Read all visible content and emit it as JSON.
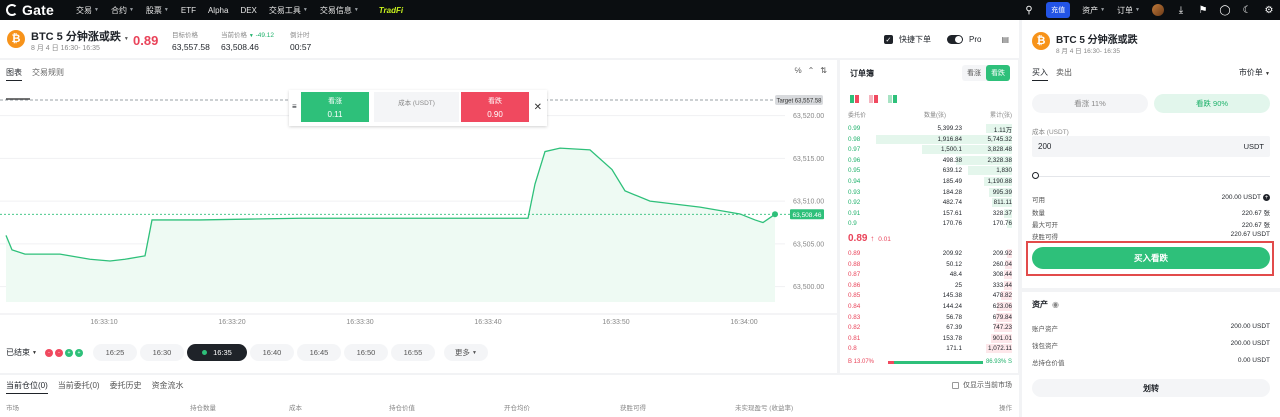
{
  "nav": {
    "brand": "Gate",
    "items": [
      "交易",
      "合约",
      "股票",
      "ETF",
      "Alpha",
      "DEX",
      "交易工具",
      "交易信息"
    ],
    "has_caret": [
      true,
      true,
      true,
      false,
      false,
      false,
      true,
      true
    ],
    "tradfi": "TradFi",
    "deposit": "充值",
    "assets": "资产",
    "orders": "订单"
  },
  "header": {
    "title": "BTC 5 分钟涨或跌",
    "subtitle": "8 月 4 日 16:30- 16:35",
    "price": "0.89",
    "target_label": "目标价格",
    "target_value": "63,557.58",
    "current_label": "当前价格",
    "current_value": "63,508.46",
    "current_change": "-49.12",
    "countdown_label": "倒计时",
    "countdown_value": "00:57",
    "quick_order": "快捷下单",
    "pro": "Pro"
  },
  "chart_tabs": [
    "图表",
    "交易规则"
  ],
  "popover": {
    "up_label": "看涨",
    "up_value": "0.11",
    "cost_label": "成本 (USDT)",
    "down_label": "看跌",
    "down_value": "0.90"
  },
  "chart_data": {
    "type": "line",
    "x_ticks": [
      "16:33:10",
      "16:33:20",
      "16:33:30",
      "16:33:40",
      "16:33:50",
      "16:34:00"
    ],
    "y_ticks": [
      63500,
      63505,
      63510,
      63515,
      63520
    ],
    "ylim": [
      63498.2,
      63522.3
    ],
    "x_range": [
      63,
      822
    ],
    "series": [
      {
        "name": "",
        "x": [
          6,
          12,
          25,
          60,
          90,
          110,
          125,
          145,
          152,
          200,
          250,
          300,
          400,
          480,
          500,
          528,
          535,
          545,
          560,
          590,
          612,
          625,
          650,
          700,
          740,
          755,
          763,
          775
        ],
        "y": [
          63506.0,
          63504.3,
          63503.8,
          63503.8,
          63503.2,
          63503.0,
          63503.2,
          63503.6,
          63507.8,
          63507.8,
          63507.9,
          63508.0,
          63508.0,
          63508.0,
          63508.0,
          63508.0,
          63512.0,
          63515.8,
          63516.2,
          63516.0,
          63513.7,
          63511.2,
          63510.0,
          63509.3,
          63508.5,
          63507.8,
          63507.5,
          63508.46
        ]
      }
    ],
    "target_label": "Target 63,557.58",
    "current_tag": "63,508.46"
  },
  "timebar": {
    "ended": "已结束",
    "dots": [
      "-",
      "-",
      "+",
      "+"
    ],
    "slots": [
      "16:25",
      "16:30",
      "16:35",
      "16:40",
      "16:45",
      "16:50",
      "16:55"
    ],
    "active": 2,
    "more": "更多"
  },
  "bottom": {
    "tabs": [
      "当前仓位(0)",
      "当前委托(0)",
      "委托历史",
      "资金流水"
    ],
    "only_current": "仅显示当前市场",
    "columns": [
      "市场",
      "持仓数量",
      "成本",
      "持仓价值",
      "开仓均价",
      "获胜可得",
      "未实现盈亏 (收益率)",
      "操作"
    ]
  },
  "orderbook": {
    "title": "订单簿",
    "tab_up": "看涨",
    "tab_down": "看跌",
    "h_price": "委托价",
    "h_qty": "数量(张)",
    "h_total": "累计(张)",
    "asks": [
      [
        "0.99",
        "5,399.23",
        "1.11万",
        16
      ],
      [
        "0.98",
        "1,916.84",
        "5,745.32",
        83
      ],
      [
        "0.97",
        "1,500.1",
        "3,828.48",
        55
      ],
      [
        "0.96",
        "498.38",
        "2,328.38",
        34
      ],
      [
        "0.95",
        "639.12",
        "1,830",
        27
      ],
      [
        "0.94",
        "185.49",
        "1,190.88",
        17
      ],
      [
        "0.93",
        "184.28",
        "995.39",
        14
      ],
      [
        "0.92",
        "482.74",
        "811.11",
        12
      ],
      [
        "0.91",
        "157.61",
        "328.37",
        5
      ],
      [
        "0.9",
        "170.76",
        "170.76",
        3
      ]
    ],
    "mid_price": "0.89",
    "mid_change": "0.01",
    "bids": [
      [
        "0.89",
        "209.92",
        "209.92",
        3
      ],
      [
        "0.88",
        "50.12",
        "260.04",
        4
      ],
      [
        "0.87",
        "48.4",
        "308.44",
        5
      ],
      [
        "0.86",
        "25",
        "333.44",
        5
      ],
      [
        "0.85",
        "145.38",
        "478.82",
        7
      ],
      [
        "0.84",
        "144.24",
        "623.06",
        9
      ],
      [
        "0.83",
        "56.78",
        "679.84",
        10
      ],
      [
        "0.82",
        "67.39",
        "747.23",
        11
      ],
      [
        "0.81",
        "153.78",
        "901.01",
        13
      ],
      [
        "0.8",
        "171.1",
        "1,072.11",
        16
      ]
    ],
    "buy_pct": "B 13.07%",
    "sell_pct": "86.93% S"
  },
  "order": {
    "title": "BTC 5 分钟涨或跌",
    "subtitle": "8 月 4 日 16:30- 16:35",
    "tab_buy": "买入",
    "tab_sell": "卖出",
    "order_type": "市价单",
    "up_btn": "看涨 11%",
    "down_btn": "看跌 90%",
    "cost_label": "成本 (USDT)",
    "amount": "200",
    "currency": "USDT",
    "available_label": "可用",
    "available_value": "200.00 USDT",
    "qty_label": "数量",
    "qty_value": "220.67 张",
    "max_label": "最大可开",
    "max_value": "220.67 张",
    "win_label": "获胜可得",
    "win_value": "220.67 USDT",
    "buy_button": "买入看跌",
    "assets_title": "资产",
    "account_label": "账户资产",
    "account_value": "200.00 USDT",
    "wallet_label": "钱包资产",
    "wallet_value": "200.00 USDT",
    "position_label": "总持仓价值",
    "position_value": "0.00 USDT",
    "transfer": "划转"
  }
}
